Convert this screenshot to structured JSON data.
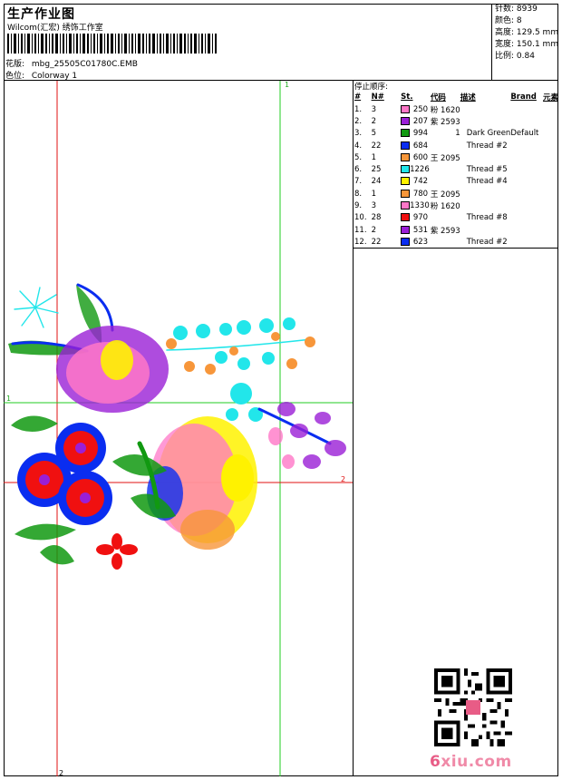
{
  "header": {
    "title": "生产作业图",
    "company": "Wilcom(汇宏) 绣饰工作室",
    "design_label": "花版:",
    "design_file": "mbg_25505C01780C.EMB",
    "colorway_label": "色位:",
    "colorway": "Colorway 1"
  },
  "stats": [
    {
      "label": "针数:",
      "value": "8939"
    },
    {
      "label": "颜色:",
      "value": "8"
    },
    {
      "label": "高度:",
      "value": "129.5 mm"
    },
    {
      "label": "宽度:",
      "value": "150.1 mm"
    },
    {
      "label": "比例:",
      "value": "0.84"
    }
  ],
  "guides": {
    "h1_label": "1",
    "v1_label": "1",
    "h2_label": "2",
    "v2_label": "2"
  },
  "stop_sequence": {
    "title": "停止顺序:",
    "columns": [
      "#",
      "N#",
      "St.",
      "代码",
      "描述",
      "Brand",
      "元素"
    ],
    "rows": [
      {
        "idx": "1.",
        "n": "3",
        "color": "#ff77c8",
        "st": "250",
        "code": "粉 1620",
        "desc": "",
        "brand": ""
      },
      {
        "idx": "2.",
        "n": "2",
        "color": "#9a1fd6",
        "st": "207",
        "code": "紫 2593",
        "desc": "",
        "brand": ""
      },
      {
        "idx": "3.",
        "n": "5",
        "color": "#119911",
        "st": "994",
        "code": "1",
        "desc": "Dark Green",
        "brand": "Default"
      },
      {
        "idx": "4.",
        "n": "22",
        "color": "#0a2df0",
        "st": "684",
        "code": "",
        "desc": "Thread #2",
        "brand": ""
      },
      {
        "idx": "5.",
        "n": "1",
        "color": "#f7963a",
        "st": "600",
        "code": "王 2095",
        "desc": "",
        "brand": ""
      },
      {
        "idx": "6.",
        "n": "25",
        "color": "#22e6ea",
        "st": "1226",
        "code": "",
        "desc": "Thread #5",
        "brand": ""
      },
      {
        "idx": "7.",
        "n": "24",
        "color": "#fff200",
        "st": "742",
        "code": "",
        "desc": "Thread #4",
        "brand": ""
      },
      {
        "idx": "8.",
        "n": "1",
        "color": "#f7963a",
        "st": "780",
        "code": "王 2095",
        "desc": "",
        "brand": ""
      },
      {
        "idx": "9.",
        "n": "3",
        "color": "#ff77c8",
        "st": "1330",
        "code": "粉 1620",
        "desc": "",
        "brand": ""
      },
      {
        "idx": "10.",
        "n": "28",
        "color": "#f01010",
        "st": "970",
        "code": "",
        "desc": "Thread #8",
        "brand": ""
      },
      {
        "idx": "11.",
        "n": "2",
        "color": "#9a1fd6",
        "st": "531",
        "code": "紫 2593",
        "desc": "",
        "brand": ""
      },
      {
        "idx": "12.",
        "n": "22",
        "color": "#0a2df0",
        "st": "623",
        "code": "",
        "desc": "Thread #2",
        "brand": ""
      }
    ]
  },
  "watermark": {
    "prefix": "6",
    "text": "xiu.com"
  },
  "colors": {
    "guide_red": "#e01010",
    "guide_green": "#22cc22"
  }
}
